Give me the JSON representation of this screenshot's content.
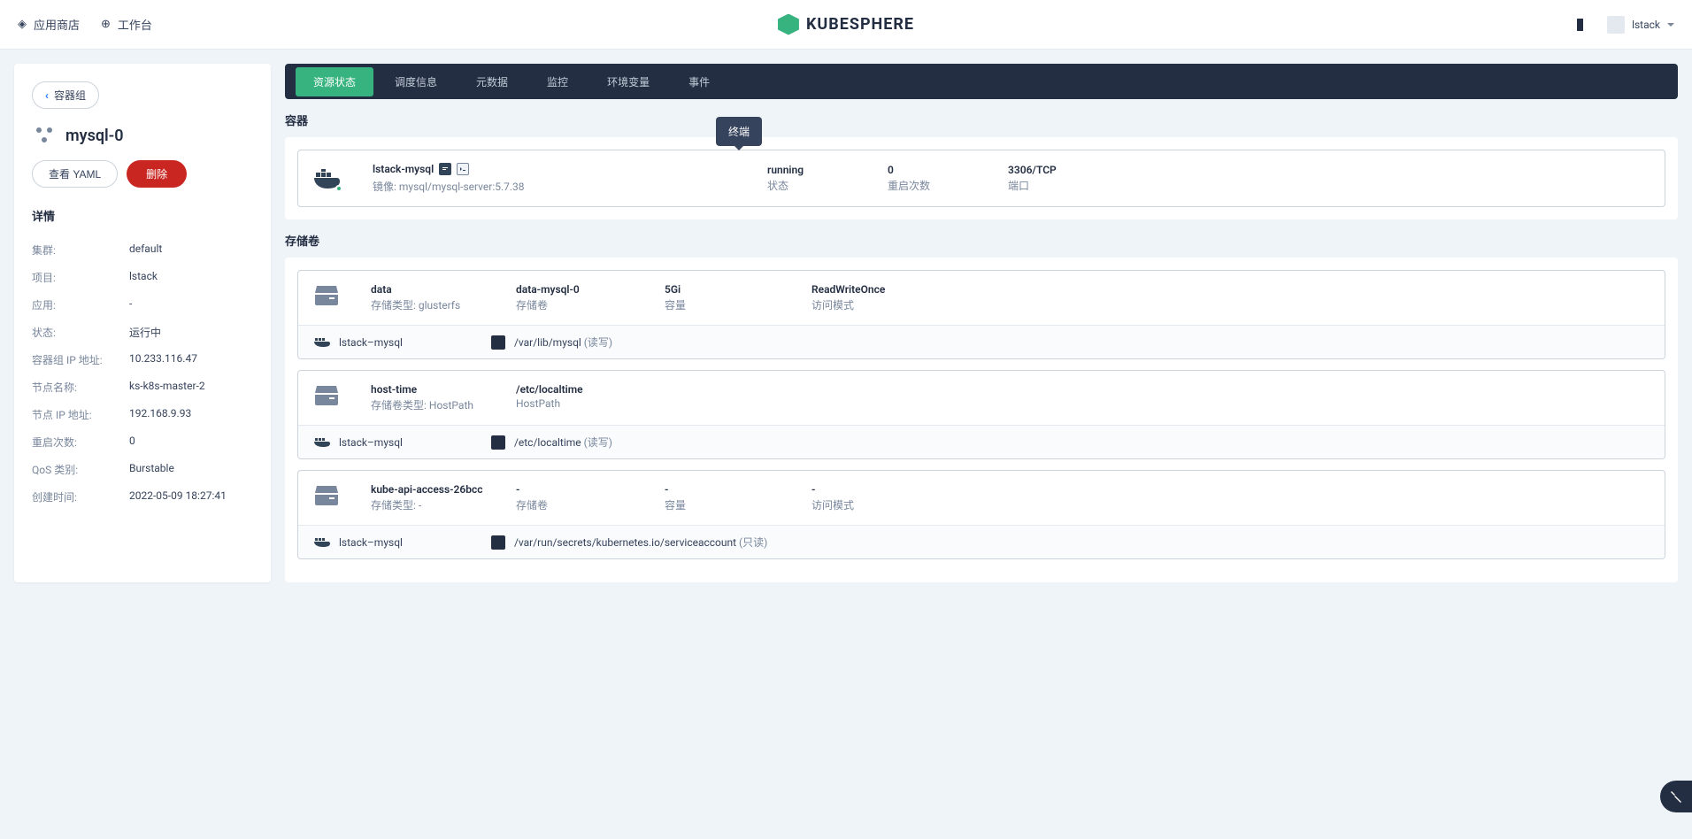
{
  "header": {
    "appstore": "应用商店",
    "workspace": "工作台",
    "logo": "KUBESPHERE",
    "username": "lstack"
  },
  "sidebar": {
    "back_label": "容器组",
    "pod_name": "mysql-0",
    "btn_yaml": "查看 YAML",
    "btn_delete": "删除",
    "details_title": "详情",
    "rows": [
      {
        "label": "集群:",
        "value": "default"
      },
      {
        "label": "项目:",
        "value": "lstack"
      },
      {
        "label": "应用:",
        "value": "-"
      },
      {
        "label": "状态:",
        "value": "运行中"
      },
      {
        "label": "容器组 IP 地址:",
        "value": "10.233.116.47"
      },
      {
        "label": "节点名称:",
        "value": "ks-k8s-master-2"
      },
      {
        "label": "节点 IP 地址:",
        "value": "192.168.9.93"
      },
      {
        "label": "重启次数:",
        "value": "0"
      },
      {
        "label": "QoS 类别:",
        "value": "Burstable"
      },
      {
        "label": "创建时间:",
        "value": "2022-05-09 18:27:41"
      }
    ]
  },
  "tabs": [
    "资源状态",
    "调度信息",
    "元数据",
    "监控",
    "环境变量",
    "事件"
  ],
  "tooltip": "终端",
  "container_section": {
    "title": "容器",
    "name": "lstack-mysql",
    "image_label": "镜像:",
    "image": "mysql/mysql-server:5.7.38",
    "status": "running",
    "status_label": "状态",
    "restarts": "0",
    "restarts_label": "重启次数",
    "ports": "3306/TCP",
    "ports_label": "端口"
  },
  "volumes_section": {
    "title": "存储卷",
    "volumes": [
      {
        "name": "data",
        "type_label": "存储类型:",
        "type": "glusterfs",
        "pvc": "data-mysql-0",
        "pvc_label": "存储卷",
        "size": "5Gi",
        "size_label": "容量",
        "mode": "ReadWriteOnce",
        "mode_label": "访问模式",
        "mount_container": "lstack–mysql",
        "mount_path": "/var/lib/mysql",
        "mount_mode": "(读写)"
      },
      {
        "name": "host-time",
        "type_label": "存储卷类型:",
        "type": "HostPath",
        "pvc": "/etc/localtime",
        "pvc_label": "HostPath",
        "size": "",
        "size_label": "",
        "mode": "",
        "mode_label": "",
        "mount_container": "lstack–mysql",
        "mount_path": "/etc/localtime",
        "mount_mode": "(读写)"
      },
      {
        "name": "kube-api-access-26bcc",
        "type_label": "存储类型:",
        "type": "-",
        "pvc": "-",
        "pvc_label": "存储卷",
        "size": "-",
        "size_label": "容量",
        "mode": "-",
        "mode_label": "访问模式",
        "mount_container": "lstack–mysql",
        "mount_path": "/var/run/secrets/kubernetes.io/serviceaccount",
        "mount_mode": "(只读)"
      }
    ]
  }
}
